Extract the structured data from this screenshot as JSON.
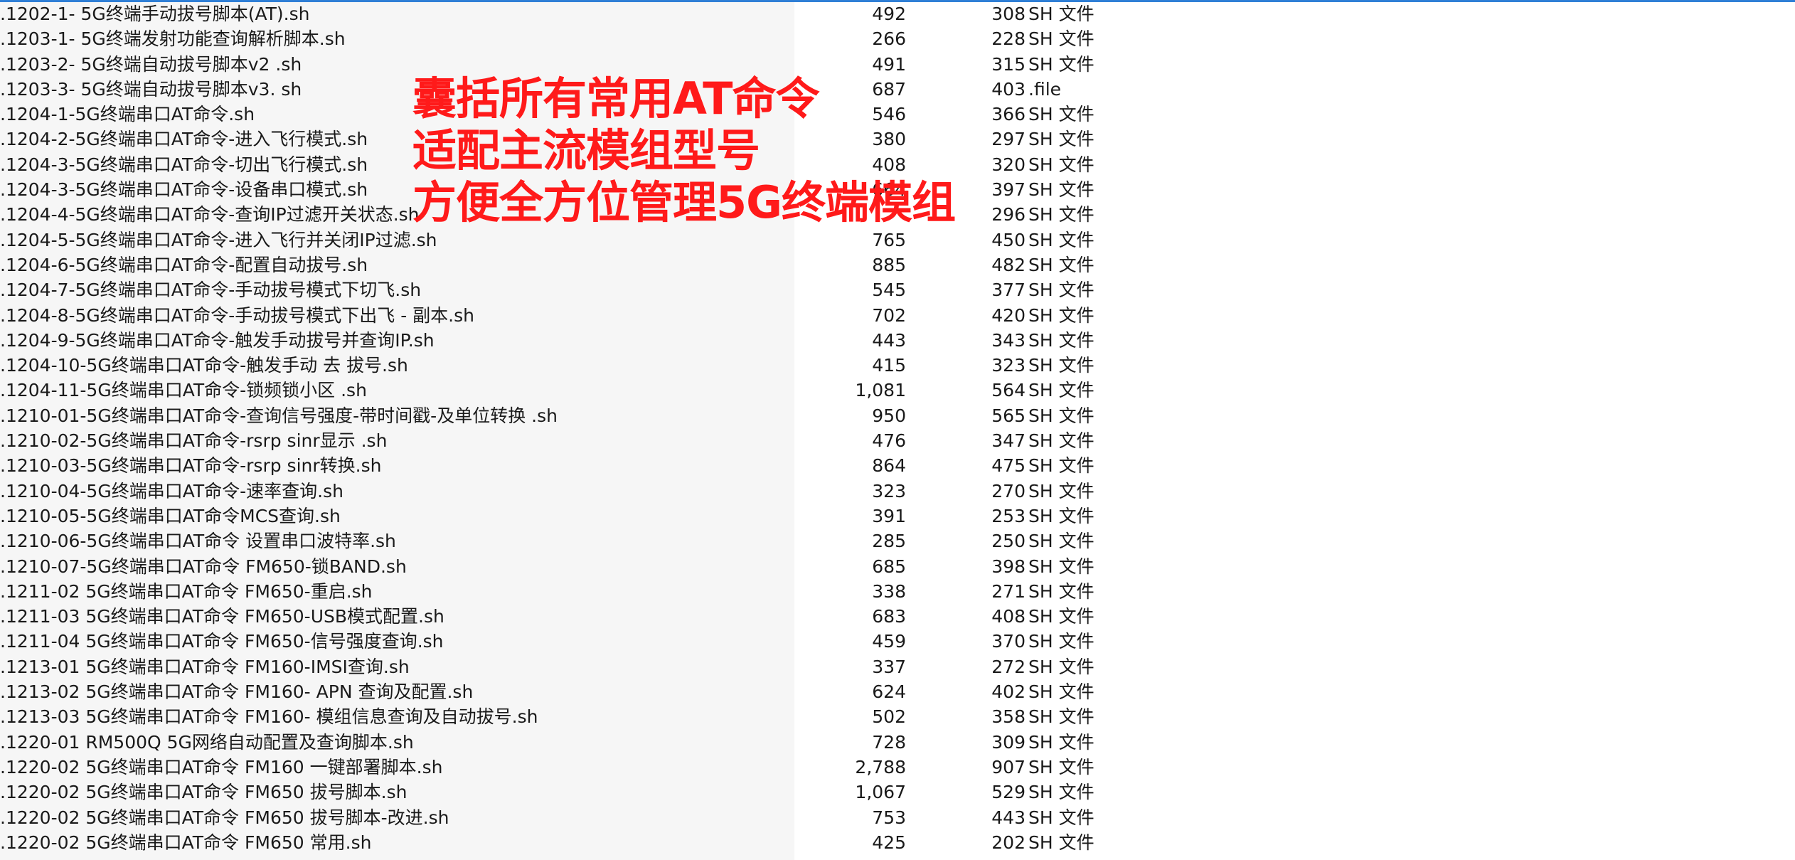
{
  "overlay": {
    "lines": [
      "囊括所有常用AT命令",
      "适配主流模组型号",
      "方便全方位管理5G终端模组"
    ]
  },
  "colors": {
    "overlay_text": "#ff1a1a",
    "selection_line": "#2f7fd6",
    "name_column_bg": "#f6f6f6"
  },
  "files": [
    {
      "name": ".1202-1- 5G终端手动拔号脚本(AT).sh",
      "size": "492",
      "packed": "308",
      "type": "SH 文件"
    },
    {
      "name": ".1203-1- 5G终端发射功能查询解析脚本.sh",
      "size": "266",
      "packed": "228",
      "type": "SH 文件"
    },
    {
      "name": ".1203-2- 5G终端自动拔号脚本v2 .sh",
      "size": "491",
      "packed": "315",
      "type": "SH 文件"
    },
    {
      "name": ".1203-3- 5G终端自动拔号脚本v3. sh",
      "size": "687",
      "packed": "403",
      "type": ".file"
    },
    {
      "name": ".1204-1-5G终端串口AT命令.sh",
      "size": "546",
      "packed": "366",
      "type": "SH 文件"
    },
    {
      "name": ".1204-2-5G终端串口AT命令-进入飞行模式.sh",
      "size": "380",
      "packed": "297",
      "type": "SH 文件"
    },
    {
      "name": ".1204-3-5G终端串口AT命令-切出飞行模式.sh",
      "size": "408",
      "packed": "320",
      "type": "SH 文件"
    },
    {
      "name": ".1204-3-5G终端串口AT命令-设备串口模式.sh",
      "size": "664",
      "packed": "397",
      "type": "SH 文件"
    },
    {
      "name": ".1204-4-5G终端串口AT命令-查询IP过滤开关状态.sh",
      "size": "",
      "packed": "296",
      "type": "SH 文件"
    },
    {
      "name": ".1204-5-5G终端串口AT命令-进入飞行并关闭IP过滤.sh",
      "size": "765",
      "packed": "450",
      "type": "SH 文件"
    },
    {
      "name": ".1204-6-5G终端串口AT命令-配置自动拔号.sh",
      "size": "885",
      "packed": "482",
      "type": "SH 文件"
    },
    {
      "name": ".1204-7-5G终端串口AT命令-手动拔号模式下切飞.sh",
      "size": "545",
      "packed": "377",
      "type": "SH 文件"
    },
    {
      "name": ".1204-8-5G终端串口AT命令-手动拔号模式下出飞 - 副本.sh",
      "size": "702",
      "packed": "420",
      "type": "SH 文件"
    },
    {
      "name": ".1204-9-5G终端串口AT命令-触发手动拔号并查询IP.sh",
      "size": "443",
      "packed": "343",
      "type": "SH 文件"
    },
    {
      "name": ".1204-10-5G终端串口AT命令-触发手动 去 拔号.sh",
      "size": "415",
      "packed": "323",
      "type": "SH 文件"
    },
    {
      "name": ".1204-11-5G终端串口AT命令-锁频锁小区 .sh",
      "size": "1,081",
      "packed": "564",
      "type": "SH 文件"
    },
    {
      "name": ".1210-01-5G终端串口AT命令-查询信号强度-带时间戳-及单位转换  .sh",
      "size": "950",
      "packed": "565",
      "type": "SH 文件"
    },
    {
      "name": ".1210-02-5G终端串口AT命令-rsrp sinr显示  .sh",
      "size": "476",
      "packed": "347",
      "type": "SH 文件"
    },
    {
      "name": ".1210-03-5G终端串口AT命令-rsrp sinr转换.sh",
      "size": "864",
      "packed": "475",
      "type": "SH 文件"
    },
    {
      "name": ".1210-04-5G终端串口AT命令-速率查询.sh",
      "size": "323",
      "packed": "270",
      "type": "SH 文件"
    },
    {
      "name": ".1210-05-5G终端串口AT命令MCS查询.sh",
      "size": "391",
      "packed": "253",
      "type": "SH 文件"
    },
    {
      "name": ".1210-06-5G终端串口AT命令 设置串口波特率.sh",
      "size": "285",
      "packed": "250",
      "type": "SH 文件"
    },
    {
      "name": ".1210-07-5G终端串口AT命令 FM650-锁BAND.sh",
      "size": "685",
      "packed": "398",
      "type": "SH 文件"
    },
    {
      "name": ".1211-02   5G终端串口AT命令 FM650-重启.sh",
      "size": "338",
      "packed": "271",
      "type": "SH 文件"
    },
    {
      "name": ".1211-03  5G终端串口AT命令 FM650-USB模式配置.sh",
      "size": "683",
      "packed": "408",
      "type": "SH 文件"
    },
    {
      "name": ".1211-04  5G终端串口AT命令 FM650-信号强度查询.sh",
      "size": "459",
      "packed": "370",
      "type": "SH 文件"
    },
    {
      "name": ".1213-01  5G终端串口AT命令 FM160-IMSI查询.sh",
      "size": "337",
      "packed": "272",
      "type": "SH 文件"
    },
    {
      "name": ".1213-02  5G终端串口AT命令 FM160- APN 查询及配置.sh",
      "size": "624",
      "packed": "402",
      "type": "SH 文件"
    },
    {
      "name": ".1213-03  5G终端串口AT命令 FM160- 模组信息查询及自动拔号.sh",
      "size": "502",
      "packed": "358",
      "type": "SH 文件"
    },
    {
      "name": ".1220-01 RM500Q 5G网络自动配置及查询脚本.sh",
      "size": "728",
      "packed": "309",
      "type": "SH 文件"
    },
    {
      "name": ".1220-02 5G终端串口AT命令 FM160 一键部署脚本.sh",
      "size": "2,788",
      "packed": "907",
      "type": "SH 文件"
    },
    {
      "name": ".1220-02 5G终端串口AT命令 FM650 拔号脚本.sh",
      "size": "1,067",
      "packed": "529",
      "type": "SH 文件"
    },
    {
      "name": ".1220-02 5G终端串口AT命令 FM650 拔号脚本-改进.sh",
      "size": "753",
      "packed": "443",
      "type": "SH 文件"
    },
    {
      "name": ".1220-02 5G终端串口AT命令 FM650 常用.sh",
      "size": "425",
      "packed": "202",
      "type": "SH 文件"
    }
  ]
}
